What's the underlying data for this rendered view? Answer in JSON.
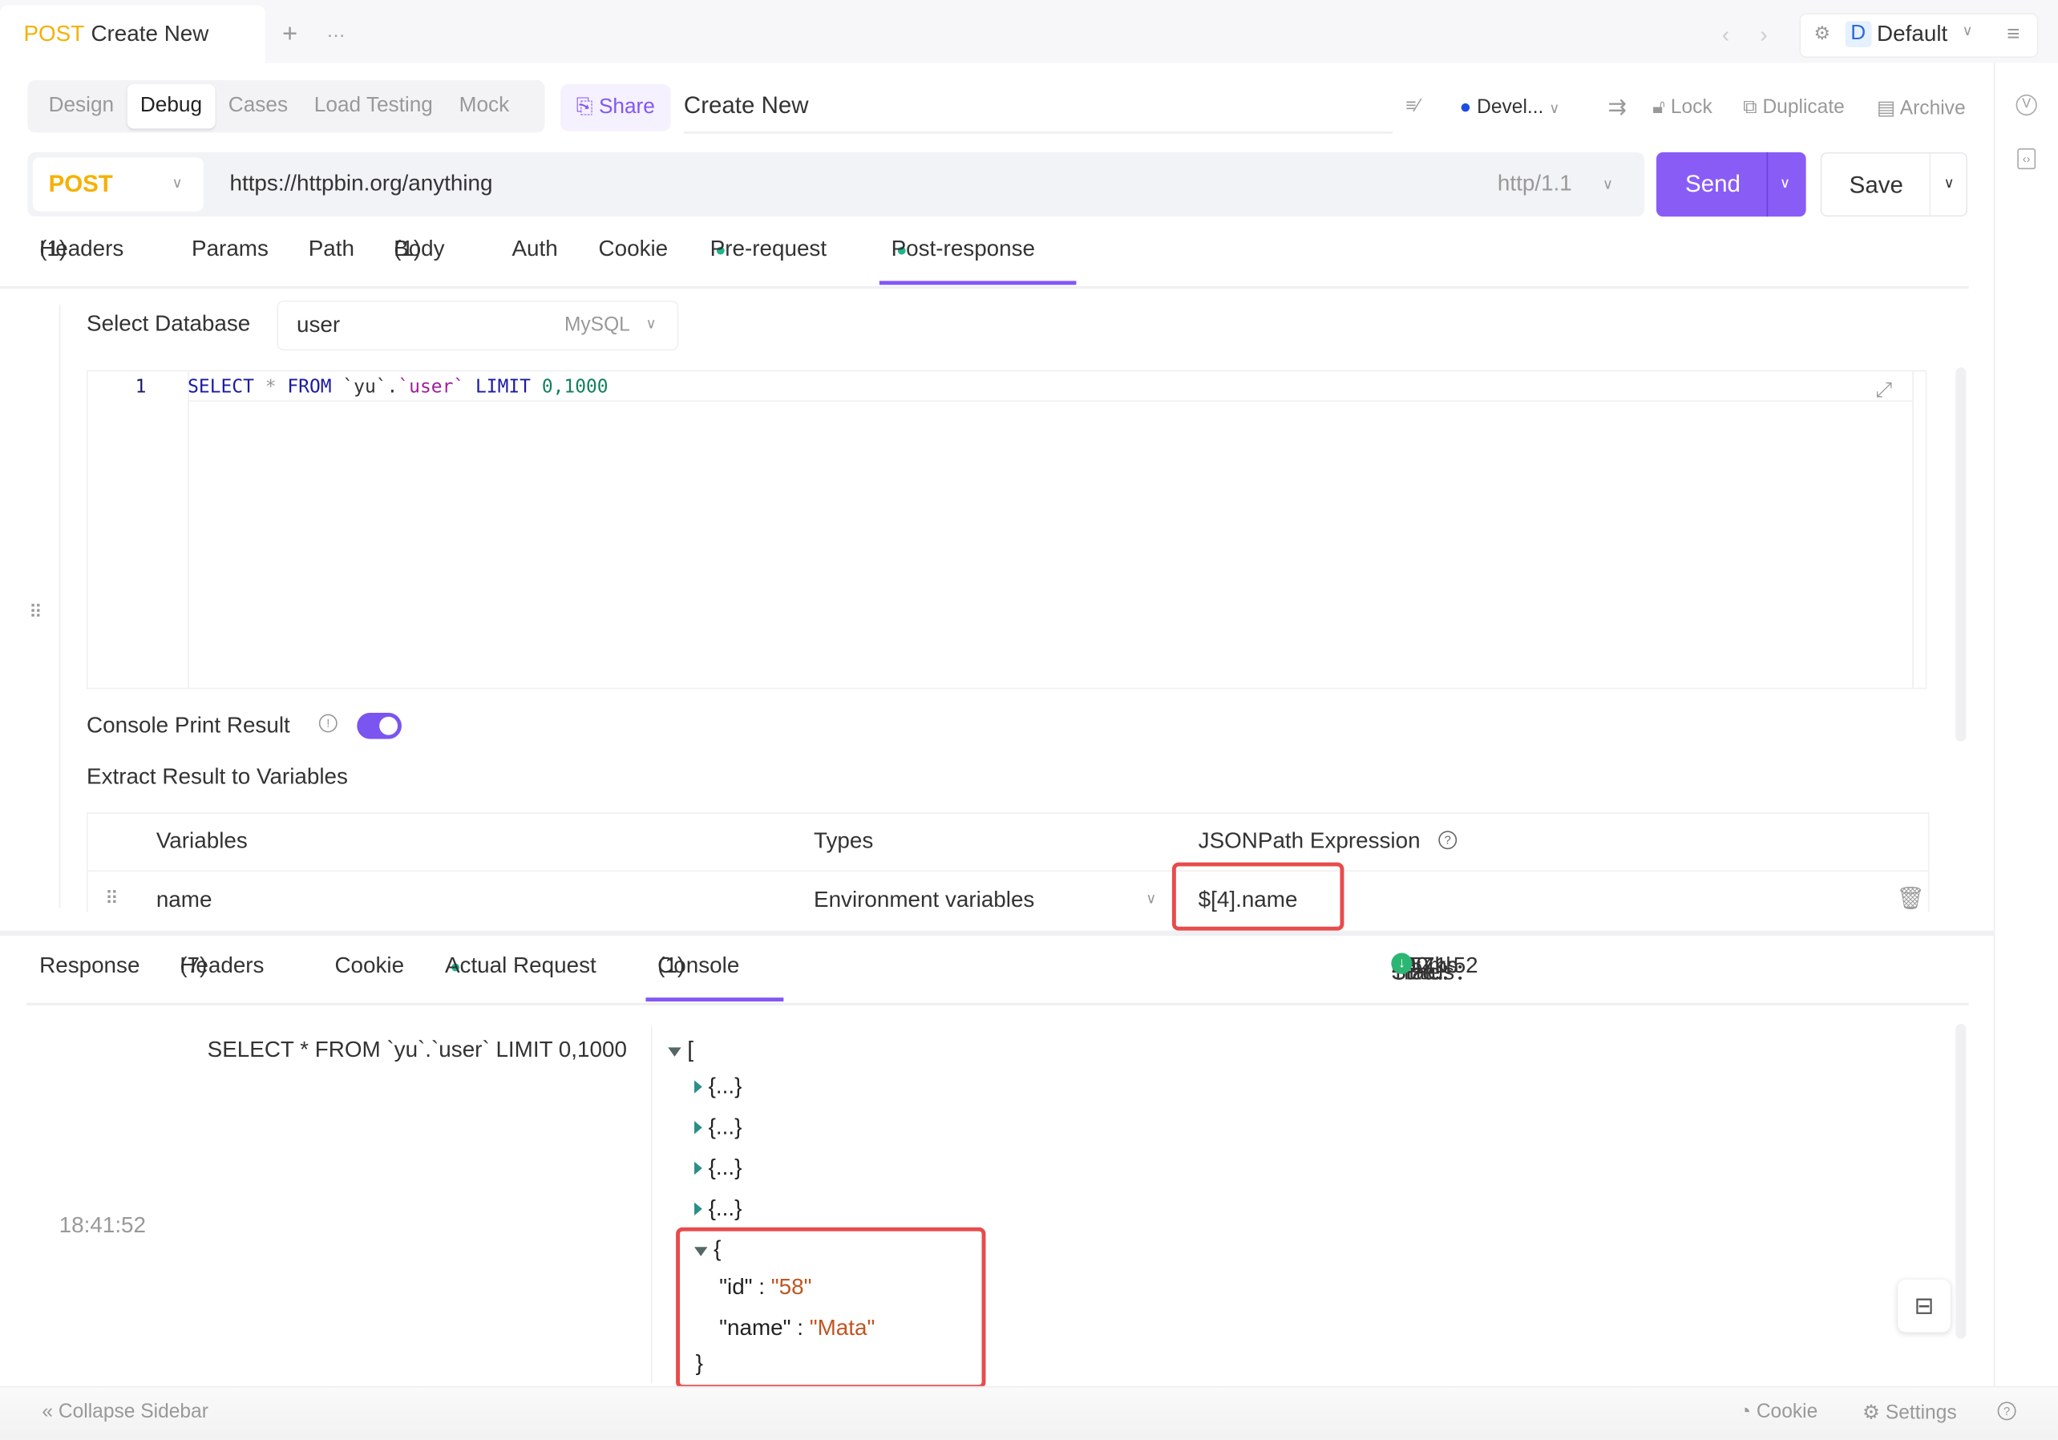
{
  "tab": {
    "method": "POST",
    "title": "Create New",
    "add": "+",
    "more": "···"
  },
  "topright": {
    "env_initial": "D",
    "env_name": "Default"
  },
  "modes": [
    "Design",
    "Debug",
    "Cases",
    "Load Testing",
    "Mock"
  ],
  "share": "Share",
  "request_name": "Create New",
  "toolbar": {
    "env": "Devel...",
    "lock": "Lock",
    "duplicate": "Duplicate",
    "archive": "Archive"
  },
  "url": {
    "method": "POST",
    "value": "https://httpbin.org/anything",
    "protocol": "http/1.1",
    "send": "Send",
    "save": "Save"
  },
  "req_tabs": [
    {
      "label": "Headers",
      "count": "(1)"
    },
    {
      "label": "Params"
    },
    {
      "label": "Path"
    },
    {
      "label": "Body",
      "count": "(1)"
    },
    {
      "label": "Auth"
    },
    {
      "label": "Cookie"
    },
    {
      "label": "Pre-request"
    },
    {
      "label": "Post-response"
    }
  ],
  "db": {
    "label": "Select Database",
    "value": "user",
    "type": "MySQL"
  },
  "sql": {
    "line": "1",
    "select": "SELECT",
    "star": "*",
    "from": "FROM",
    "schema": "`yu`.",
    "table": "`user`",
    "limit": "LIMIT",
    "nums": "0,1000"
  },
  "console_print": {
    "label": "Console Print Result",
    "enabled": true
  },
  "extract_label": "Extract Result to Variables",
  "vars_table": {
    "headers": [
      "Variables",
      "Types",
      "JSONPath Expression"
    ],
    "rows": [
      {
        "name": "name",
        "type": "Environment variables",
        "expr": "$[4].name"
      }
    ]
  },
  "resp_tabs": [
    {
      "label": "Response"
    },
    {
      "label": "Headers",
      "count": "(7)"
    },
    {
      "label": "Cookie"
    },
    {
      "label": "Actual Request"
    },
    {
      "label": "Console",
      "count": "(1)"
    }
  ],
  "status": {
    "status_label": "Status：",
    "status": "200",
    "time_label": "Time：",
    "time": "18:41:52",
    "duration": "290ms",
    "size_label": "Size：",
    "size": "0.57kb"
  },
  "console": {
    "query": "SELECT * FROM `yu`.`user` LIMIT 0,1000",
    "timestamp": "18:41:52",
    "collapsed": [
      "{...}",
      "{...}",
      "{...}",
      "{...}"
    ],
    "open_brace": "{",
    "id_key": "\"id\"",
    "id_val": "\"58\"",
    "name_key": "\"name\"",
    "name_val": "\"Mata\"",
    "close_brace": "}",
    "array_open": "["
  },
  "footer": {
    "collapse": "Collapse Sidebar",
    "cookie": "Cookie",
    "settings": "Settings"
  },
  "colors": {
    "accent": "#8a5cf6",
    "success": "#22b58c",
    "method": "#f5b100",
    "highlight": "#e84b4b"
  }
}
